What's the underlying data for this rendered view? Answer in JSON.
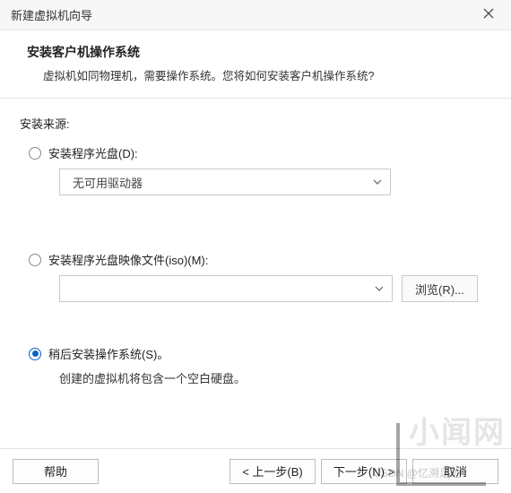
{
  "window": {
    "title": "新建虚拟机向导"
  },
  "header": {
    "title": "安装客户机操作系统",
    "subtitle": "虚拟机如同物理机，需要操作系统。您将如何安装客户机操作系统?"
  },
  "source": {
    "label": "安装来源:",
    "opt_disc": {
      "label": "安装程序光盘(D):",
      "selected": false
    },
    "opt_iso": {
      "label": "安装程序光盘映像文件(iso)(M):",
      "selected": false
    },
    "opt_later": {
      "label": "稍后安装操作系统(S)。",
      "selected": true
    },
    "drive_combo": {
      "value": "无可用驱动器"
    },
    "iso_combo": {
      "value": ""
    },
    "browse_label": "浏览(R)...",
    "later_note": "创建的虚拟机将包含一个空白硬盘。"
  },
  "footer": {
    "help": "帮助",
    "back": "< 上一步(B)",
    "next": "下一步(N) >",
    "cancel": "取消"
  },
  "watermark": {
    "main": "小闻网",
    "sub": "CSDN @忆溯足迹"
  }
}
